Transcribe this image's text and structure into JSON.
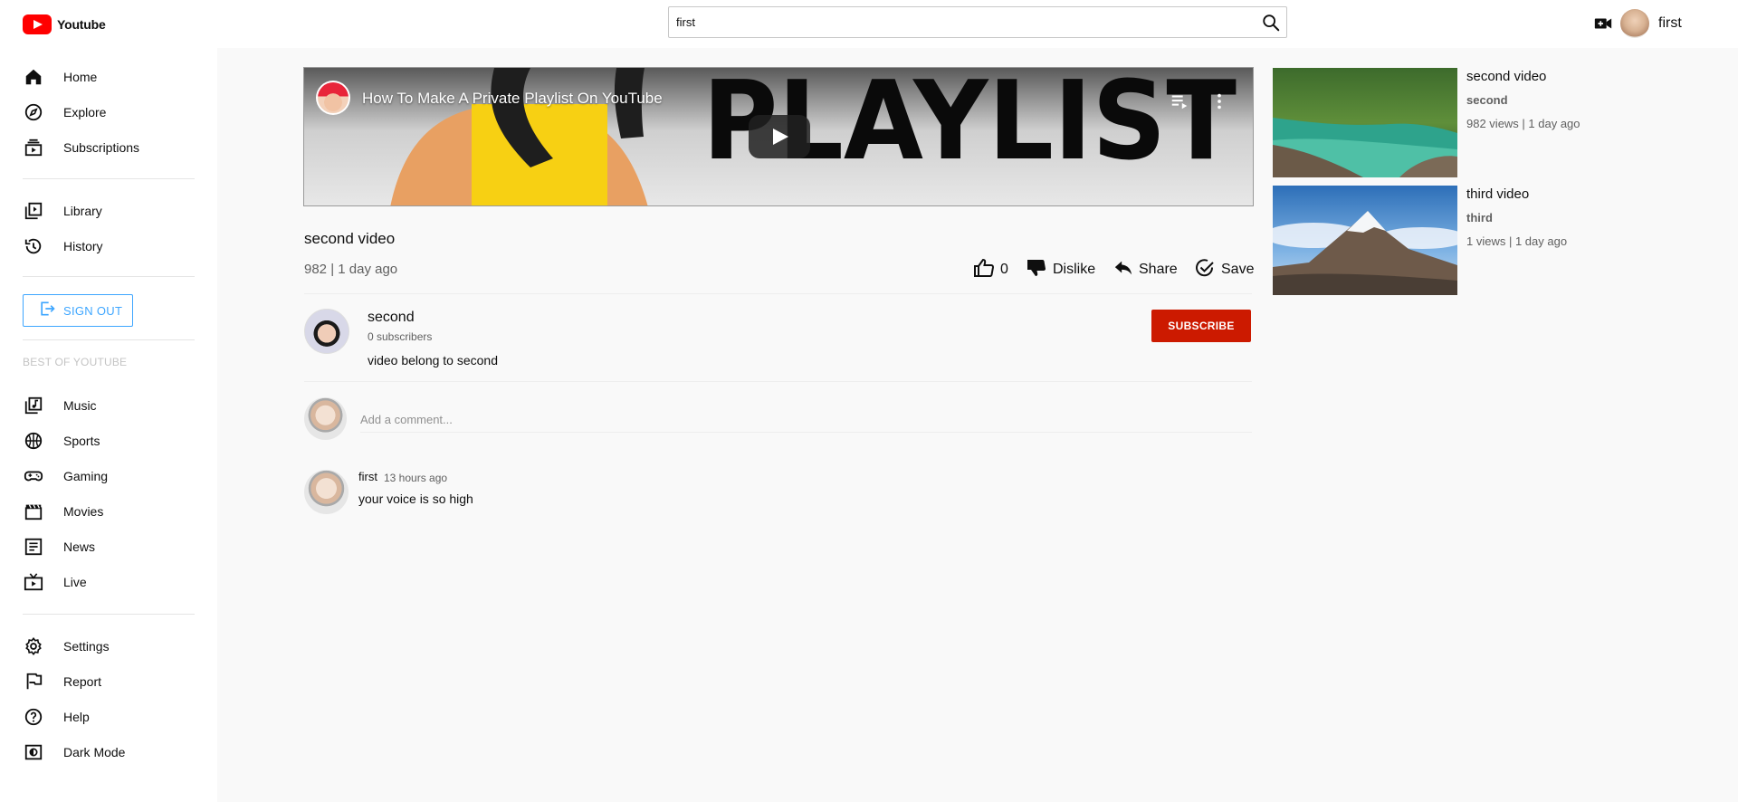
{
  "app": {
    "logo_text": "Youtube"
  },
  "search": {
    "value": "first",
    "placeholder": ""
  },
  "header": {
    "user_name": "first"
  },
  "sidebar": {
    "items": [
      {
        "label": "Home",
        "icon": "home-icon"
      },
      {
        "label": "Explore",
        "icon": "explore-icon"
      },
      {
        "label": "Subscriptions",
        "icon": "subscriptions-icon"
      },
      {
        "label": "Library",
        "icon": "library-icon"
      },
      {
        "label": "History",
        "icon": "history-icon"
      }
    ],
    "signout_label": "SIGN OUT",
    "section_title": "BEST OF YOUTUBE",
    "best_items": [
      {
        "label": "Music",
        "icon": "music-icon"
      },
      {
        "label": "Sports",
        "icon": "sports-icon"
      },
      {
        "label": "Gaming",
        "icon": "gaming-icon"
      },
      {
        "label": "Movies",
        "icon": "movies-icon"
      },
      {
        "label": "News",
        "icon": "news-icon"
      },
      {
        "label": "Live",
        "icon": "live-icon"
      }
    ],
    "bottom_items": [
      {
        "label": "Settings",
        "icon": "settings-icon"
      },
      {
        "label": "Report",
        "icon": "flag-icon"
      },
      {
        "label": "Help",
        "icon": "help-icon"
      },
      {
        "label": "Dark Mode",
        "icon": "dark-mode-icon"
      }
    ]
  },
  "player": {
    "embed_title": "How To Make A Private Playlist On YouTube",
    "thumbnail_text": "PLAYLIST"
  },
  "video": {
    "title": "second video",
    "meta": "982 | 1 day ago",
    "likes": "0",
    "dislike_label": "Dislike",
    "share_label": "Share",
    "save_label": "Save"
  },
  "channel": {
    "name": "second",
    "subscribers": "0 subscribers",
    "description": "video belong to second",
    "subscribe_label": "SUBSCRIBE"
  },
  "comments": {
    "placeholder": "Add a comment...",
    "list": [
      {
        "author": "first",
        "time": "13 hours ago",
        "text": "your voice is so high"
      }
    ]
  },
  "related": [
    {
      "title": "second video",
      "channel": "second",
      "meta": "982 views | 1 day ago"
    },
    {
      "title": "third video",
      "channel": "third",
      "meta": "1 views | 1 day ago"
    }
  ],
  "colors": {
    "brand": "#ff0000",
    "subscribe": "#cc1a00",
    "signout": "#3ea6ff"
  }
}
